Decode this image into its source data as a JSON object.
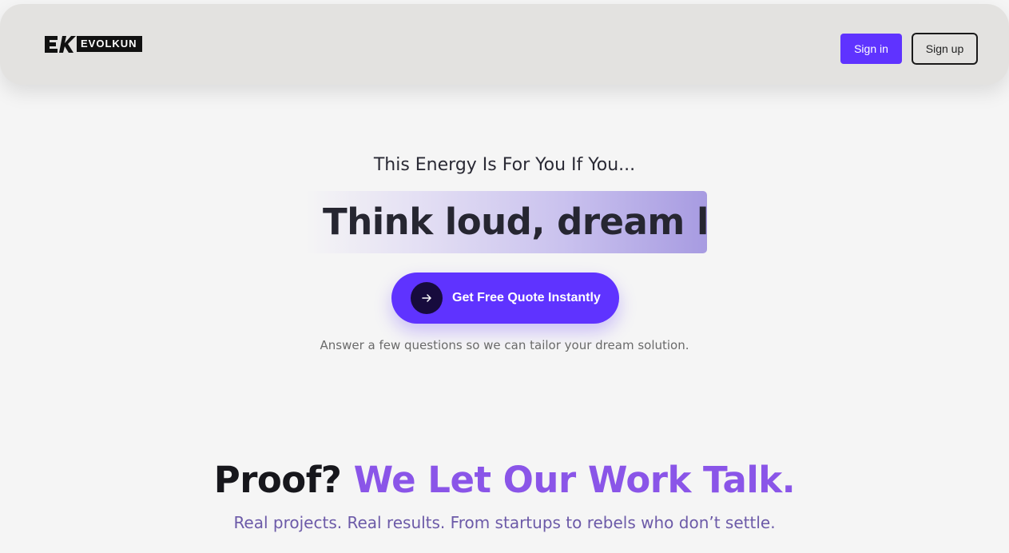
{
  "header": {
    "logo_text": "EVOLKUN",
    "signin_label": "Sign in",
    "signup_label": "Sign up"
  },
  "hero": {
    "eyebrow": "This Energy Is For You If You...",
    "headline": "Think loud, dream l",
    "cta_label": "Get Free Quote Instantly",
    "cta_icon": "arrow-right-icon",
    "subtext": "Answer a few questions so we can tailor your dream solution."
  },
  "proof": {
    "title_dark": "Proof?",
    "title_accent": "We Let Our Work Talk.",
    "subtitle": "Real projects. Real results. From startups to rebels who don’t settle."
  },
  "colors": {
    "accent": "#5f33ff",
    "accent_light": "#8a55e8",
    "background": "#f5f5f5",
    "navbar": "#e3e2e0"
  }
}
